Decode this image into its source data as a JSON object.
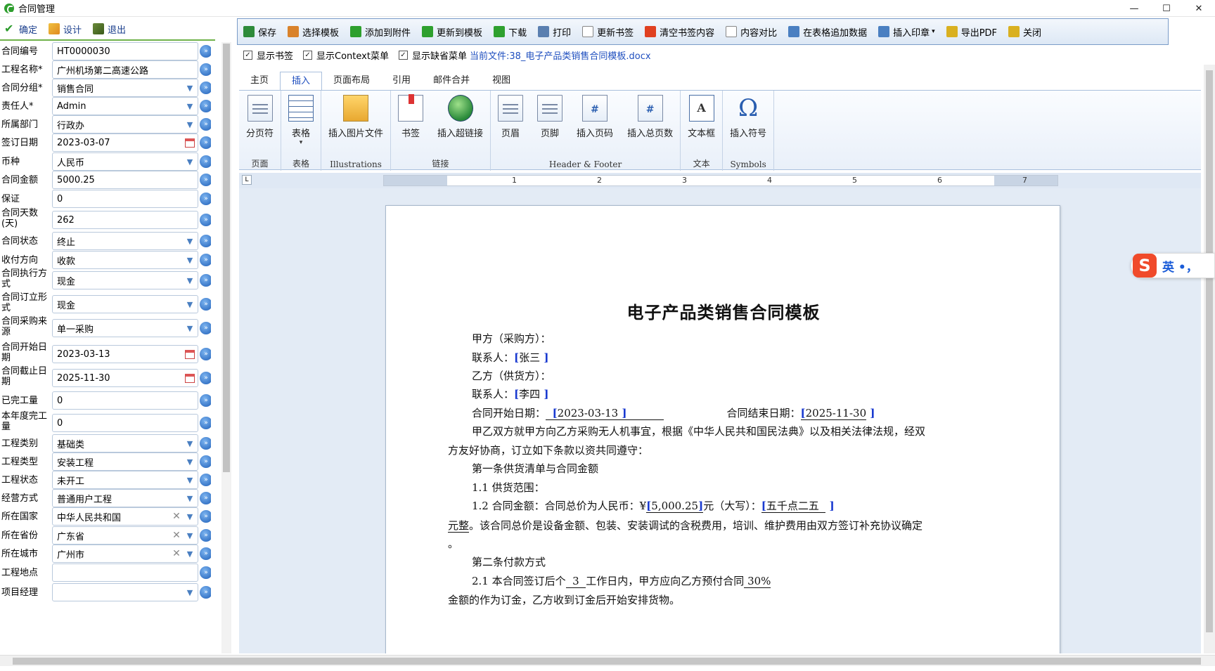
{
  "window": {
    "title": "合同管理",
    "controls": [
      "—",
      "☐",
      "✕"
    ]
  },
  "left_toolbar": {
    "confirm": "确定",
    "design": "设计",
    "exit": "退出"
  },
  "form": {
    "fields": [
      {
        "label": "合同编号",
        "value": "HT0000030",
        "type": "text"
      },
      {
        "label": "工程名称*",
        "value": "广州机场第二高速公路",
        "type": "text"
      },
      {
        "label": "合同分组*",
        "value": "销售合同",
        "type": "select"
      },
      {
        "label": "责任人*",
        "value": "Admin",
        "type": "select"
      },
      {
        "label": "所属部门",
        "value": "行政办",
        "type": "select"
      },
      {
        "label": "签订日期",
        "value": "2023-03-07",
        "type": "date"
      },
      {
        "label": "币种",
        "value": "人民币",
        "type": "select"
      },
      {
        "label": "合同金额",
        "value": "5000.25",
        "type": "text"
      },
      {
        "label": "保证",
        "value": "0",
        "type": "text"
      },
      {
        "label": "合同天数(天)",
        "value": "262",
        "type": "text"
      },
      {
        "label": "合同状态",
        "value": "终止",
        "type": "select"
      },
      {
        "label": "收付方向",
        "value": "收款",
        "type": "select"
      },
      {
        "label": "合同执行方式",
        "value": "现金",
        "type": "select"
      },
      {
        "label": "合同订立形式",
        "value": "现金",
        "type": "select"
      },
      {
        "label": "合同采购来源",
        "value": "单一采购",
        "type": "select"
      },
      {
        "label": "合同开始日期",
        "value": "2023-03-13",
        "type": "date"
      },
      {
        "label": "合同截止日期",
        "value": "2025-11-30",
        "type": "date"
      },
      {
        "label": "已完工量",
        "value": "0",
        "type": "text"
      },
      {
        "label": "本年度完工量",
        "value": "0",
        "type": "text"
      },
      {
        "label": "工程类别",
        "value": "基础类",
        "type": "select"
      },
      {
        "label": "工程类型",
        "value": "安装工程",
        "type": "select"
      },
      {
        "label": "工程状态",
        "value": "未开工",
        "type": "select"
      },
      {
        "label": "经营方式",
        "value": "普通用户工程",
        "type": "select"
      },
      {
        "label": "所在国家",
        "value": "中华人民共和国",
        "type": "select-clear"
      },
      {
        "label": "所在省份",
        "value": "广东省",
        "type": "select-clear"
      },
      {
        "label": "所在城市",
        "value": "广州市",
        "type": "select-clear"
      },
      {
        "label": "工程地点",
        "value": "",
        "type": "text"
      },
      {
        "label": "项目经理",
        "value": "",
        "type": "select"
      }
    ]
  },
  "main_toolbar": [
    {
      "label": "保存",
      "icon": "save-icon",
      "color": "#2e8b3a"
    },
    {
      "label": "选择模板",
      "icon": "template-icon",
      "color": "#d9822b"
    },
    {
      "label": "添加到附件",
      "icon": "attach-icon",
      "color": "#2ea02e"
    },
    {
      "label": "更新到模板",
      "icon": "update-icon",
      "color": "#2ea02e"
    },
    {
      "label": "下载",
      "icon": "download-icon",
      "color": "#2ea02e"
    },
    {
      "label": "打印",
      "icon": "print-icon",
      "color": "#5a7fb0"
    },
    {
      "label": "更新书签",
      "icon": "bookmark-refresh-icon",
      "color": "#ffffff"
    },
    {
      "label": "清空书签内容",
      "icon": "clear-icon",
      "color": "#e04020"
    },
    {
      "label": "内容对比",
      "icon": "compare-icon",
      "color": "#ffffff"
    },
    {
      "label": "在表格追加数据",
      "icon": "table-add-icon",
      "color": "#4a7fc1"
    },
    {
      "label": "插入印章",
      "icon": "seal-icon",
      "color": "#4a7fc1",
      "caret": "▾"
    },
    {
      "label": "导出PDF",
      "icon": "pdf-icon",
      "color": "#d9b020"
    },
    {
      "label": "关闭",
      "icon": "close-doc-icon",
      "color": "#d9b020"
    }
  ],
  "options": {
    "show_bookmark": "显示书签",
    "show_context": "显示Context菜单",
    "show_default_menu": "显示缺省菜单",
    "current_file": "当前文件:38_电子产品类销售合同模板.docx"
  },
  "ribbon_tabs": [
    "主页",
    "插入",
    "页面布局",
    "引用",
    "邮件合并",
    "视图"
  ],
  "ribbon_groups": [
    {
      "caption": "页面",
      "buttons": [
        {
          "label": "分页符",
          "icon": "page-break-icon"
        }
      ]
    },
    {
      "caption": "表格",
      "buttons": [
        {
          "label": "表格",
          "icon": "table-icon",
          "caret": "▾"
        }
      ]
    },
    {
      "caption": "Illustrations",
      "buttons": [
        {
          "label": "插入图片文件",
          "icon": "picture-icon"
        }
      ]
    },
    {
      "caption": "链接",
      "buttons": [
        {
          "label": "书签",
          "icon": "bookmark-icon"
        },
        {
          "label": "插入超链接",
          "icon": "hyperlink-icon"
        }
      ]
    },
    {
      "caption": "Header & Footer",
      "buttons": [
        {
          "label": "页眉",
          "icon": "header-icon"
        },
        {
          "label": "页脚",
          "icon": "footer-icon"
        },
        {
          "label": "插入页码",
          "icon": "page-number-icon"
        },
        {
          "label": "插入总页数",
          "icon": "total-pages-icon"
        }
      ]
    },
    {
      "caption": "文本",
      "buttons": [
        {
          "label": "文本框",
          "icon": "textbox-icon"
        }
      ]
    },
    {
      "caption": "Symbols",
      "buttons": [
        {
          "label": "插入符号",
          "icon": "omega-icon"
        }
      ]
    }
  ],
  "ruler": {
    "numbers": [
      "1",
      "2",
      "3",
      "4",
      "5",
      "6",
      "7"
    ],
    "corner": "L"
  },
  "document": {
    "title": "电子产品类销售合同模板",
    "party_a": "甲方（采购方）：",
    "contact_a_label": "联系人：",
    "contact_a": "张三",
    "party_b": "乙方（供货方）：",
    "contact_b_label": "联系人：",
    "contact_b": "李四",
    "start_label": "合同开始日期：",
    "start_date": "2023-03-13",
    "end_label": "合同结束日期：",
    "end_date": "2025-11-30",
    "para1a": "甲乙双方就甲方向乙方采购无人机事宜，根据《中华人民共和国民法典》以及相关法律法规，经双",
    "para1b": "方友好协商，订立如下条款以资共同遵守：",
    "sec1": "第一条供货清单与合同金额",
    "sec1_1": "1.1 供货范围：",
    "sec1_2_prefix": "1.2 合同金额：合同总价为人民币：¥",
    "amount": "5,000.25",
    "amount_mid": "元（大写）：",
    "amount_cn": "五千点二五",
    "para2a_bm": "元整",
    "para2a": "。该合同总价是设备金额、包装、安装调试的含税费用，培训、维护费用由双方签订补充协议确定",
    "para2b": "。",
    "sec2": "第二条付款方式",
    "sec2_1_prefix": "2.1 本合同签订后个",
    "days": "3",
    "sec2_1_mid": "工作日内，甲方应向乙方预付合同",
    "percent": "30%",
    "para3": "金额的作为订金，乙方收到订金后开始安排货物。"
  },
  "ime": {
    "logo": "S",
    "mode": "英 •，"
  }
}
